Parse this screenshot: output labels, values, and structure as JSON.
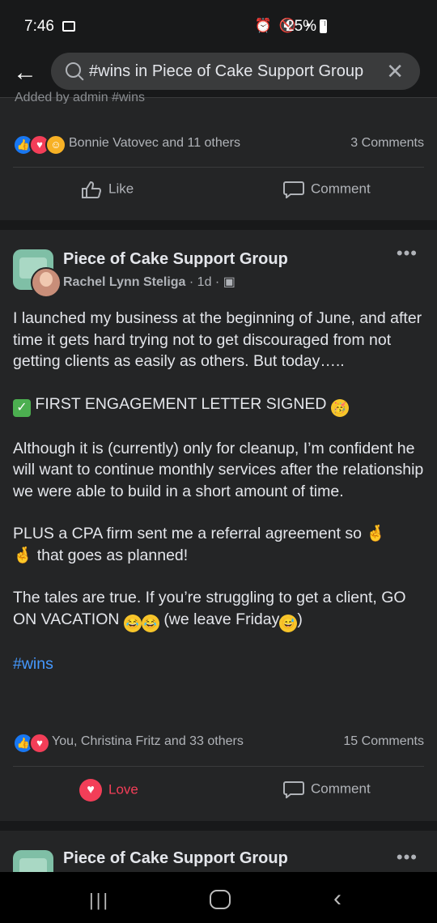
{
  "status_bar": {
    "time": "7:46",
    "battery": "25%"
  },
  "search": {
    "query": "#wins in Piece of Cake Support Group"
  },
  "prev_post": {
    "peek_text": "Added by admin #wins",
    "reactions_text": "Bonnie Vatovec and 11 others",
    "comments": "3 Comments",
    "like_label": "Like",
    "comment_label": "Comment"
  },
  "post": {
    "group_name": "Piece of Cake Support Group",
    "author": "Rachel Lynn Steliga",
    "time": "1d",
    "paragraphs": [
      "I launched my business at the beginning of June, and after time it gets hard trying not to get discouraged from not getting clients as easily as others. But today…..",
      "FIRST ENGAGEMENT LETTER SIGNED",
      "Although it is (currently) only for cleanup, I’m confident he will want to continue monthly services after the relationship we were able to build in a short amount of time.",
      "PLUS a CPA firm sent me a referral agreement so",
      "that goes as planned!",
      "The tales are true. If you’re struggling to get a client, GO ON VACATION",
      "(we leave Friday",
      ")"
    ],
    "hashtag": "#wins",
    "reactions_text": "You, Christina Fritz and 33 others",
    "comments": "15 Comments",
    "love_label": "Love",
    "comment_label": "Comment"
  },
  "next_post": {
    "group_name": "Piece of Cake Support Group"
  },
  "colors": {
    "background": "#18191a",
    "card": "#242526",
    "link": "#4599ff",
    "love": "#f33e58",
    "like": "#1877f2"
  }
}
